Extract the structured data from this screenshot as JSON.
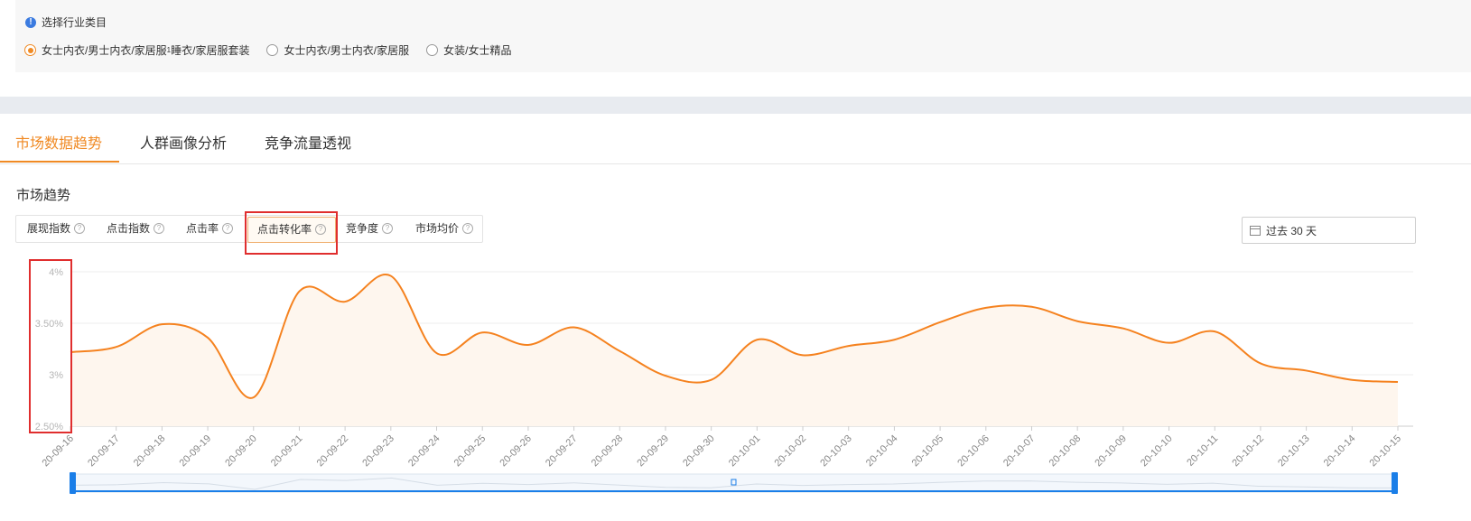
{
  "industry": {
    "title": "选择行业类目",
    "options": [
      {
        "label": "女士内衣/男士内衣/家居服",
        "selected": true,
        "sub": "1",
        "tail": "睡衣/家居服套装"
      },
      {
        "label": "女士内衣/男士内衣/家居服",
        "selected": false
      },
      {
        "label": "女装/女士精品",
        "selected": false
      }
    ]
  },
  "tabs": [
    "市场数据趋势",
    "人群画像分析",
    "竞争流量透视"
  ],
  "active_tab": 0,
  "section_title": "市场趋势",
  "metrics": [
    "展现指数",
    "点击指数",
    "点击率",
    "点击转化率",
    "竞争度",
    "市场均价"
  ],
  "active_metric": 3,
  "help_glyph": "?",
  "date_range": "过去 30 天",
  "colors": {
    "accent": "#f08a24",
    "line": "#f5821f",
    "highlight": "#e02e2e",
    "slider": "#1a7ee8"
  },
  "chart_data": {
    "type": "area",
    "x": [
      "20-09-16",
      "20-09-17",
      "20-09-18",
      "20-09-19",
      "20-09-20",
      "20-09-21",
      "20-09-22",
      "20-09-23",
      "20-09-24",
      "20-09-25",
      "20-09-26",
      "20-09-27",
      "20-09-28",
      "20-09-29",
      "20-09-30",
      "20-10-01",
      "20-10-02",
      "20-10-03",
      "20-10-04",
      "20-10-05",
      "20-10-06",
      "20-10-07",
      "20-10-08",
      "20-10-09",
      "20-10-10",
      "20-10-11",
      "20-10-12",
      "20-10-13",
      "20-10-14",
      "20-10-15"
    ],
    "values": [
      3.22,
      3.27,
      3.49,
      3.36,
      2.78,
      3.81,
      3.71,
      3.96,
      3.21,
      3.41,
      3.29,
      3.46,
      3.23,
      2.99,
      2.95,
      3.34,
      3.19,
      3.28,
      3.34,
      3.51,
      3.65,
      3.66,
      3.52,
      3.45,
      3.31,
      3.42,
      3.11,
      3.04,
      2.95,
      2.93
    ],
    "y_ticks": [
      "4%",
      "3.50%",
      "3%",
      "2.50%"
    ],
    "y_tick_values": [
      4,
      3.5,
      3,
      2.5
    ],
    "ylim": [
      2.5,
      4
    ],
    "grid": true,
    "legend": "none",
    "xlabel": "",
    "ylabel": ""
  }
}
